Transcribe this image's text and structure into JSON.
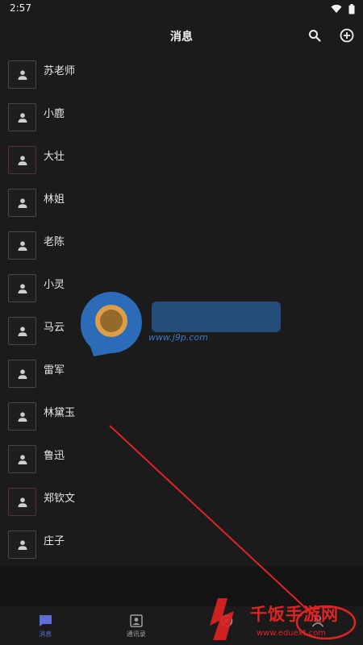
{
  "status_bar": {
    "time": "2:57"
  },
  "header": {
    "title": "消息",
    "search_icon": "search-icon",
    "add_icon": "add-circle-icon"
  },
  "contacts": [
    {
      "name": "苏老师",
      "avatar_border": "#4a4a3a"
    },
    {
      "name": "小鹿",
      "avatar_border": "#4a4a3a"
    },
    {
      "name": "大壮",
      "avatar_border": "#5a3030"
    },
    {
      "name": "林姐",
      "avatar_border": "#4a4a3a"
    },
    {
      "name": "老陈",
      "avatar_border": "#4a4a3a"
    },
    {
      "name": "小灵",
      "avatar_border": "#4a4a3a"
    },
    {
      "name": "马云",
      "avatar_border": "#4a4a3a"
    },
    {
      "name": "雷军",
      "avatar_border": "#4a4a3a"
    },
    {
      "name": "林黛玉",
      "avatar_border": "#4a4a3a"
    },
    {
      "name": "鲁迅",
      "avatar_border": "#4a4a3a"
    },
    {
      "name": "郑钦文",
      "avatar_border": "#5a3030"
    },
    {
      "name": "庄子",
      "avatar_border": "#4a4a3a"
    }
  ],
  "tabbar": {
    "tabs": [
      {
        "label": "消息",
        "icon": "chat-icon",
        "active": true
      },
      {
        "label": "通讯录",
        "icon": "contacts-icon",
        "active": false
      },
      {
        "label": "",
        "icon": "discover-icon",
        "active": false
      },
      {
        "label": "",
        "icon": "profile-icon",
        "active": false
      }
    ]
  },
  "watermarks": {
    "center_url": "www.j9p.com",
    "bottom_text": "千饭手游网",
    "bottom_url": "www.eduext.com"
  },
  "colors": {
    "background": "#1b1b1b",
    "accent": "#5b6fd6",
    "annotation_red": "#e02424"
  }
}
